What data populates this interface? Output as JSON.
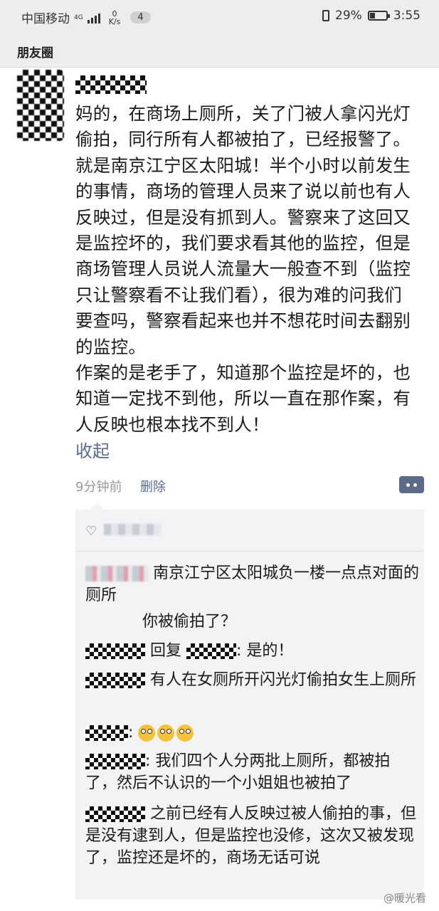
{
  "status_bar": {
    "carrier": "中国移动",
    "network_type": "4G",
    "net_speed_value": "0",
    "net_speed_unit": "K/s",
    "notification_count": "4",
    "battery": "29%",
    "time": "3:55"
  },
  "header": {
    "title": "朋友圈"
  },
  "post": {
    "text": "妈的，在商场上厕所，关了门被人拿闪光灯偷拍，同行所有人都被拍了，已经报警了。就是南京江宁区太阳城！半个小时以前发生的事情，商场的管理人员来了说以前也有人反映过，但是没有抓到人。警察来了这回又是监控坏的，我们要求看其他的监控，但是商场管理人员说人流量大一般查不到（监控只让警察看不让我们看），很为难的问我们要查吗，警察看起来也并不想花时间去翻别的监控。\n作案的是老手了，知道那个监控是坏的，也知道一定找不到他，所以一直在那作案，有人反映也根本找不到人！",
    "collapse_label": "收起",
    "time": "9分钟前",
    "delete_label": "删除"
  },
  "comments": [
    {
      "text": "南京江宁区太阳城负一楼一点点对面的厕所"
    },
    {
      "text": "你被偷拍了？"
    },
    {
      "reply_prefix": "回复",
      "text": "是的！"
    },
    {
      "text": "有人在女厕所开闪光灯偷拍女生上厕所"
    },
    {
      "emoji": "😳😳😳"
    },
    {
      "text": "我们四个人分两批上厕所，都被拍了，然后不认识的一个小姐姐也被拍了"
    },
    {
      "text": "之前已经有人反映过被人偷拍的事，但是没有逮到人，但是监控也没修，这次又被发现了，监控还是坏的，商场无话可说"
    }
  ],
  "watermark": "@暖光看"
}
